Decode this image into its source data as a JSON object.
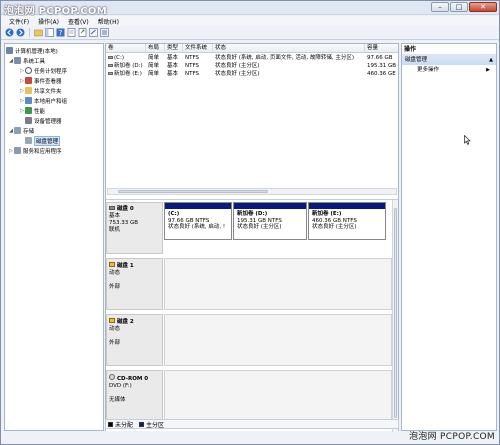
{
  "title_bar": {
    "watermark": "泡泡网 PCPOP.COM"
  },
  "window_controls": {
    "minimize": "–",
    "maximize": "□",
    "close": "✕"
  },
  "menu": [
    "文件(F)",
    "操作(A)",
    "查看(V)",
    "帮助(H)"
  ],
  "toolbar_icons": [
    "back-arrow-icon",
    "forward-arrow-icon",
    "up-folder-icon",
    "console-tree-icon",
    "help-icon",
    "properties-icon",
    "export-icon",
    "refresh-icon",
    "view-icon"
  ],
  "tree": [
    {
      "label": "计算机管理(本地)",
      "level": 0,
      "toggle": "",
      "icon": "computer-icon"
    },
    {
      "label": "系统工具",
      "level": 1,
      "toggle": "◢",
      "icon": "tools-icon"
    },
    {
      "label": "任务计划程序",
      "level": 2,
      "toggle": "▷",
      "icon": "clock-icon"
    },
    {
      "label": "事件查看器",
      "level": 2,
      "toggle": "▷",
      "icon": "event-viewer-icon"
    },
    {
      "label": "共享文件夹",
      "level": 2,
      "toggle": "▷",
      "icon": "shared-folder-icon"
    },
    {
      "label": "本地用户和组",
      "level": 2,
      "toggle": "▷",
      "icon": "users-icon"
    },
    {
      "label": "性能",
      "level": 2,
      "toggle": "▷",
      "icon": "performance-icon"
    },
    {
      "label": "设备管理器",
      "level": 2,
      "toggle": "",
      "icon": "device-manager-icon"
    },
    {
      "label": "存储",
      "level": 1,
      "toggle": "◢",
      "icon": "storage-icon"
    },
    {
      "label": "磁盘管理",
      "level": 2,
      "toggle": "",
      "icon": "disk-management-icon",
      "selected": true
    },
    {
      "label": "服务和应用程序",
      "level": 1,
      "toggle": "▷",
      "icon": "services-icon"
    }
  ],
  "volume_table": {
    "headers": [
      "卷",
      "布局",
      "类型",
      "文件系统",
      "状态",
      "容量"
    ],
    "rows": [
      [
        "(C:)",
        "简单",
        "基本",
        "NTFS",
        "状态良好 (系统, 启动, 页面文件, 活动, 故障转储, 主分区)",
        "97.66 GB"
      ],
      [
        "新加卷 (D:)",
        "简单",
        "基本",
        "NTFS",
        "状态良好 (主分区)",
        "195.31 GB"
      ],
      [
        "新加卷 (E:)",
        "简单",
        "基本",
        "NTFS",
        "状态良好 (主分区)",
        "460.36 GE"
      ]
    ]
  },
  "disks": [
    {
      "name": "磁盘 0",
      "type": "基本",
      "size": "753.33 GB",
      "status": "联机",
      "partitions": [
        {
          "name": "(C:)",
          "size": "97.66 GB NTFS",
          "status": "状态良好 (系统, 启动, !"
        },
        {
          "name": "新加卷 (D:)",
          "size": "195.31 GB NTFS",
          "status": "状态良好 (主分区)"
        },
        {
          "name": "新加卷 (E:)",
          "size": "460.36 GB NTFS",
          "status": "状态良好 (主分区)"
        }
      ]
    },
    {
      "name": "磁盘 1",
      "type": "动态",
      "size": "",
      "status": "外部",
      "partitions": []
    },
    {
      "name": "磁盘 2",
      "type": "动态",
      "size": "",
      "status": "外部",
      "partitions": []
    },
    {
      "name": "CD-ROM 0",
      "type": "DVD (F:)",
      "size": "",
      "status": "无媒体",
      "partitions": []
    }
  ],
  "legend": [
    {
      "label": "未分配",
      "color": "#000000"
    },
    {
      "label": "主分区",
      "color": "#0a1a7a"
    }
  ],
  "actions": {
    "header": "操作",
    "section": "磁盘管理",
    "more": "更多操作"
  },
  "bottom_watermark": "泡泡网 PCPOP.COM"
}
